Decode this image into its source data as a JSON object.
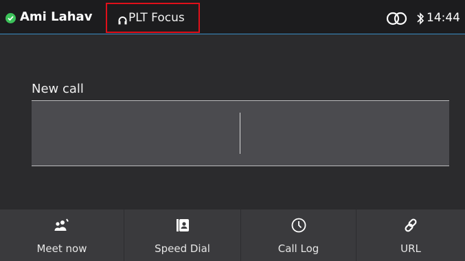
{
  "header": {
    "user_name": "Ami Lahav",
    "headset_label": "PLT Focus",
    "time": "14:44",
    "status_color": "#3cc25a",
    "highlight_color": "#e0101a",
    "divider_color": "#3a8fc7"
  },
  "main": {
    "section_label": "New call",
    "input_value": ""
  },
  "softkeys": [
    {
      "label": "Meet now",
      "icon": "meet-now-icon"
    },
    {
      "label": "Speed Dial",
      "icon": "speed-dial-icon"
    },
    {
      "label": "Call Log",
      "icon": "clock-icon"
    },
    {
      "label": "URL",
      "icon": "link-icon"
    }
  ]
}
